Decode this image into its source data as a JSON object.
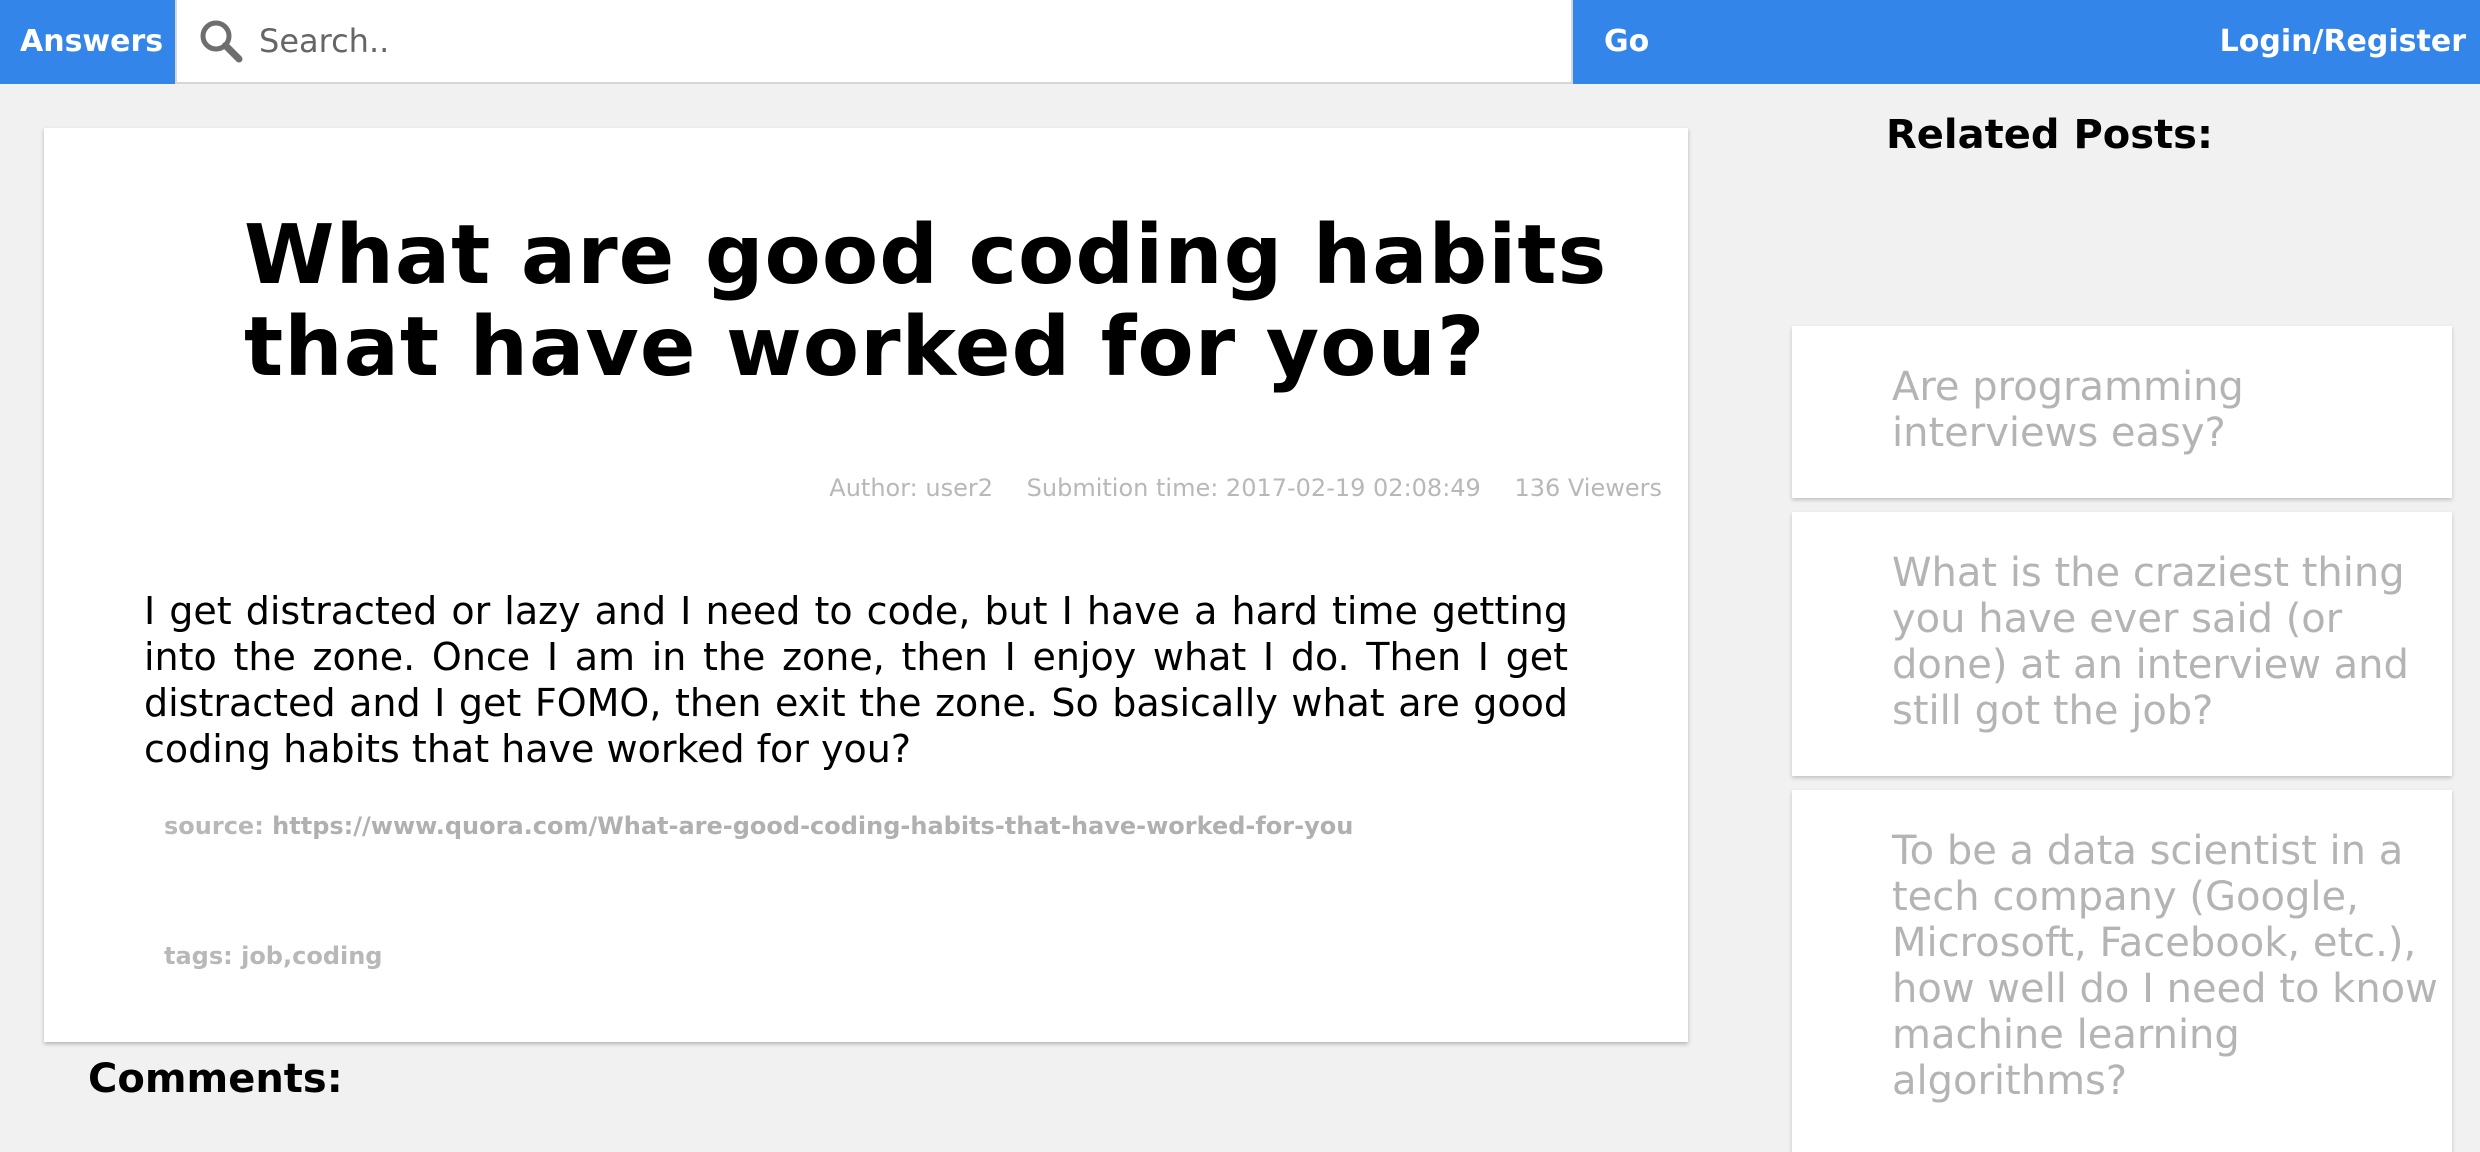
{
  "navbar": {
    "brand": "Answers",
    "search_placeholder": "Search..",
    "go_label": "Go",
    "login_label": "Login/Register",
    "color": "#3385ea"
  },
  "post": {
    "title": "What are good coding habits that have worked for you?",
    "author_label": "Author: user2",
    "submission_label": "Submition time: 2017-02-19 02:08:49",
    "views_label": "136  Viewers",
    "body": "I get distracted or lazy and I need to code, but I have a hard time getting into the zone. Once I am in the zone, then I enjoy what I do. Then I get distracted and I get FOMO, then exit the zone. So basically what are good coding habits that have worked for you?",
    "source_label": "source:",
    "source_url": "https://www.quora.com/What-are-good-coding-habits-that-have-worked-for-you",
    "tags_label": "tags: job,coding"
  },
  "comments": {
    "heading": "Comments:"
  },
  "sidebar": {
    "heading": "Related Posts:",
    "items": [
      {
        "label": "Are programming interviews easy?"
      },
      {
        "label": "What is the craziest thing you have ever said (or done) at an interview and still got the job?"
      },
      {
        "label": "To be a data scientist in a tech company (Google, Microsoft, Facebook, etc.), how well do I need to know machine learning algorithms?"
      }
    ]
  },
  "icons": {
    "search": "search-icon"
  }
}
